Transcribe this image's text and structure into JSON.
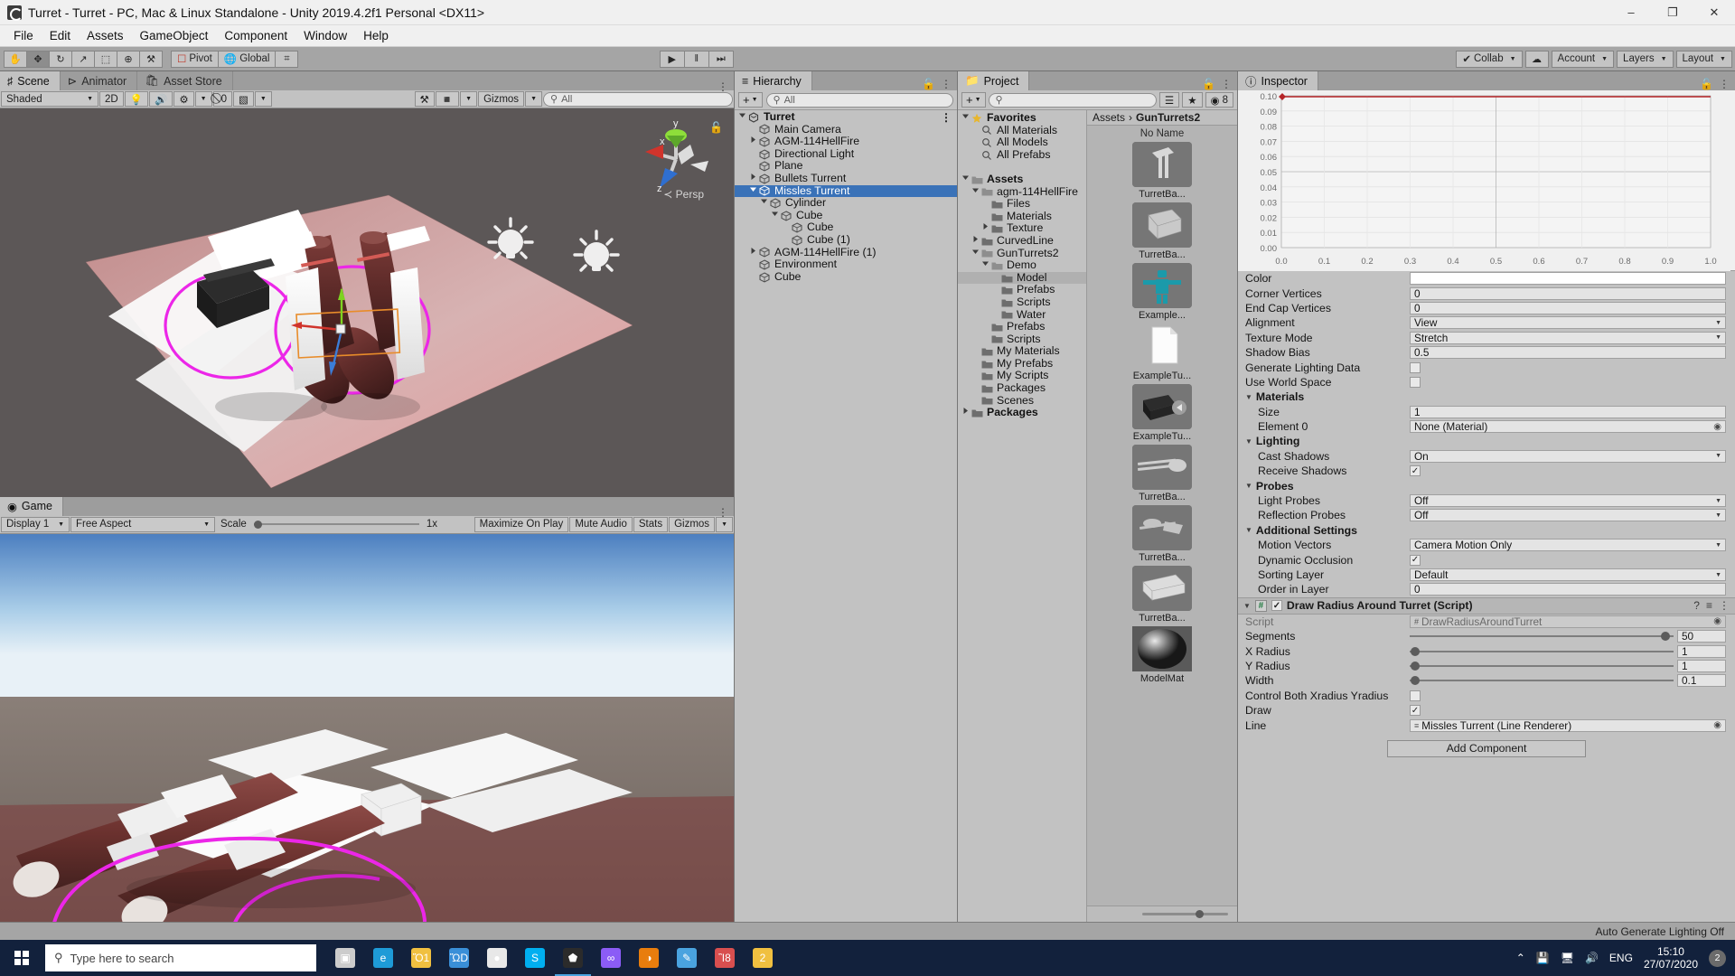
{
  "window": {
    "title": "Turret - Turret - PC, Mac & Linux Standalone - Unity 2019.4.2f1 Personal <DX11>",
    "minimize": "–",
    "maximize": "❐",
    "close": "✕"
  },
  "menubar": {
    "items": [
      "File",
      "Edit",
      "Assets",
      "GameObject",
      "Component",
      "Window",
      "Help"
    ]
  },
  "toolbar": {
    "tools": [
      {
        "name": "hand-tool",
        "glyph": "✋",
        "active": false
      },
      {
        "name": "move-tool",
        "glyph": "✥",
        "active": true
      },
      {
        "name": "rotate-tool",
        "glyph": "↻",
        "active": false
      },
      {
        "name": "scale-tool",
        "glyph": "↗",
        "active": false
      },
      {
        "name": "rect-tool",
        "glyph": "⬚",
        "active": false
      },
      {
        "name": "transform-tool",
        "glyph": "⊕",
        "active": false
      },
      {
        "name": "custom-tool",
        "glyph": "⚒",
        "active": false
      }
    ],
    "pivot_label": "Pivot",
    "global_label": "Global",
    "grid_label": "⌗",
    "play": "▶",
    "pause": "‖",
    "step": "⏭",
    "collab_label": "Collab",
    "cloud_label": "☁",
    "account_label": "Account",
    "layers_label": "Layers",
    "layout_label": "Layout"
  },
  "scene_panel": {
    "tabs": [
      {
        "label": "Scene",
        "icon": "grid-icon",
        "active": true
      },
      {
        "label": "Animator",
        "icon": "animator-icon",
        "active": false
      },
      {
        "label": "Asset Store",
        "icon": "store-icon",
        "active": false
      }
    ],
    "shading_mode": "Shaded",
    "two_d": "2D",
    "light_toggle": "Ὂ1",
    "audio_toggle": "ὐA",
    "fx_toggle": "fx",
    "hidden_count": "0",
    "gizmos_label": "Gizmos",
    "search_placeholder": "All",
    "persp_label": "Persp",
    "axis_x": "x",
    "axis_y": "y",
    "axis_z": "z"
  },
  "game_panel": {
    "tab_label": "Game",
    "display": "Display 1",
    "aspect": "Free Aspect",
    "scale_label": "Scale",
    "scale_value": "1x",
    "maximize_on_play": "Maximize On Play",
    "mute_audio": "Mute Audio",
    "stats": "Stats",
    "gizmos": "Gizmos"
  },
  "hierarchy": {
    "tab_label": "Hierarchy",
    "add_label": "+",
    "search_placeholder": "All",
    "items": [
      {
        "label": "Turret",
        "depth": 0,
        "arrow": "down",
        "bold": true,
        "selected": false,
        "icon": "unity-scene-icon"
      },
      {
        "label": "Main Camera",
        "depth": 1,
        "arrow": "none",
        "bold": false,
        "selected": false,
        "icon": "gameobject-icon"
      },
      {
        "label": "AGM-114HellFire",
        "depth": 1,
        "arrow": "right",
        "bold": false,
        "selected": false,
        "icon": "gameobject-icon"
      },
      {
        "label": "Directional Light",
        "depth": 1,
        "arrow": "none",
        "bold": false,
        "selected": false,
        "icon": "gameobject-icon"
      },
      {
        "label": "Plane",
        "depth": 1,
        "arrow": "none",
        "bold": false,
        "selected": false,
        "icon": "gameobject-icon"
      },
      {
        "label": "Bullets Turrent",
        "depth": 1,
        "arrow": "right",
        "bold": false,
        "selected": false,
        "icon": "gameobject-icon"
      },
      {
        "label": "Missles Turrent",
        "depth": 1,
        "arrow": "down",
        "bold": false,
        "selected": true,
        "icon": "gameobject-icon"
      },
      {
        "label": "Cylinder",
        "depth": 2,
        "arrow": "down",
        "bold": false,
        "selected": false,
        "icon": "gameobject-icon"
      },
      {
        "label": "Cube",
        "depth": 3,
        "arrow": "down",
        "bold": false,
        "selected": false,
        "icon": "gameobject-icon"
      },
      {
        "label": "Cube",
        "depth": 4,
        "arrow": "none",
        "bold": false,
        "selected": false,
        "icon": "gameobject-icon"
      },
      {
        "label": "Cube (1)",
        "depth": 4,
        "arrow": "none",
        "bold": false,
        "selected": false,
        "icon": "gameobject-icon"
      },
      {
        "label": "AGM-114HellFire (1)",
        "depth": 1,
        "arrow": "right",
        "bold": false,
        "selected": false,
        "icon": "gameobject-icon"
      },
      {
        "label": "Environment",
        "depth": 1,
        "arrow": "none",
        "bold": false,
        "selected": false,
        "icon": "gameobject-icon"
      },
      {
        "label": "Cube",
        "depth": 1,
        "arrow": "none",
        "bold": false,
        "selected": false,
        "icon": "gameobject-icon"
      }
    ]
  },
  "project": {
    "tab_label": "Project",
    "add_label": "+",
    "search_placeholder": "",
    "count_badge": "8",
    "breadcrumb": [
      "Assets",
      "GunTurrets2"
    ],
    "breadcrumb_sep": "›",
    "no_name_label": "No Name",
    "tree": [
      {
        "label": "Favorites",
        "depth": 0,
        "arrow": "down",
        "bold": true,
        "icon": "star-icon",
        "selected": false
      },
      {
        "label": "All Materials",
        "depth": 1,
        "arrow": "none",
        "bold": false,
        "icon": "search-icon",
        "selected": false
      },
      {
        "label": "All Models",
        "depth": 1,
        "arrow": "none",
        "bold": false,
        "icon": "search-icon",
        "selected": false
      },
      {
        "label": "All Prefabs",
        "depth": 1,
        "arrow": "none",
        "bold": false,
        "icon": "search-icon",
        "selected": false
      },
      {
        "label": "",
        "depth": 0,
        "arrow": "none",
        "bold": false,
        "icon": "none",
        "selected": false
      },
      {
        "label": "Assets",
        "depth": 0,
        "arrow": "down",
        "bold": true,
        "icon": "folder-open-icon",
        "selected": false
      },
      {
        "label": "agm-114HellFire",
        "depth": 1,
        "arrow": "down",
        "bold": false,
        "icon": "folder-open-icon",
        "selected": false
      },
      {
        "label": "Files",
        "depth": 2,
        "arrow": "none",
        "bold": false,
        "icon": "folder-icon",
        "selected": false
      },
      {
        "label": "Materials",
        "depth": 2,
        "arrow": "none",
        "bold": false,
        "icon": "folder-icon",
        "selected": false
      },
      {
        "label": "Texture",
        "depth": 2,
        "arrow": "right",
        "bold": false,
        "icon": "folder-icon",
        "selected": false
      },
      {
        "label": "CurvedLine",
        "depth": 1,
        "arrow": "right",
        "bold": false,
        "icon": "folder-icon",
        "selected": false
      },
      {
        "label": "GunTurrets2",
        "depth": 1,
        "arrow": "down",
        "bold": false,
        "icon": "folder-open-icon",
        "selected": false
      },
      {
        "label": "Demo",
        "depth": 2,
        "arrow": "down",
        "bold": false,
        "icon": "folder-open-icon",
        "selected": false
      },
      {
        "label": "Model",
        "depth": 3,
        "arrow": "none",
        "bold": false,
        "icon": "folder-icon",
        "selected": true
      },
      {
        "label": "Prefabs",
        "depth": 3,
        "arrow": "none",
        "bold": false,
        "icon": "folder-icon",
        "selected": false
      },
      {
        "label": "Scripts",
        "depth": 3,
        "arrow": "none",
        "bold": false,
        "icon": "folder-icon",
        "selected": false
      },
      {
        "label": "Water",
        "depth": 3,
        "arrow": "none",
        "bold": false,
        "icon": "folder-icon",
        "selected": false
      },
      {
        "label": "Prefabs",
        "depth": 2,
        "arrow": "none",
        "bold": false,
        "icon": "folder-icon",
        "selected": false
      },
      {
        "label": "Scripts",
        "depth": 2,
        "arrow": "none",
        "bold": false,
        "icon": "folder-icon",
        "selected": false
      },
      {
        "label": "My Materials",
        "depth": 1,
        "arrow": "none",
        "bold": false,
        "icon": "folder-icon",
        "selected": false
      },
      {
        "label": "My Prefabs",
        "depth": 1,
        "arrow": "none",
        "bold": false,
        "icon": "folder-icon",
        "selected": false
      },
      {
        "label": "My Scripts",
        "depth": 1,
        "arrow": "none",
        "bold": false,
        "icon": "folder-icon",
        "selected": false
      },
      {
        "label": "Packages",
        "depth": 1,
        "arrow": "none",
        "bold": false,
        "icon": "folder-icon",
        "selected": false
      },
      {
        "label": "Scenes",
        "depth": 1,
        "arrow": "none",
        "bold": false,
        "icon": "folder-icon",
        "selected": false
      },
      {
        "label": "Packages",
        "depth": 0,
        "arrow": "right",
        "bold": true,
        "icon": "folder-icon",
        "selected": false
      }
    ],
    "assets": [
      {
        "label": "TurretBa...",
        "kind": "model-turret-base"
      },
      {
        "label": "TurretBa...",
        "kind": "model-box"
      },
      {
        "label": "Example...",
        "kind": "model-figure"
      },
      {
        "label": "ExampleTu...",
        "kind": "script-file"
      },
      {
        "label": "ExampleTu...",
        "kind": "prefab-cannon"
      },
      {
        "label": "TurretBa...",
        "kind": "model-barrel"
      },
      {
        "label": "TurretBa...",
        "kind": "model-gun"
      },
      {
        "label": "TurretBa...",
        "kind": "model-wedge"
      },
      {
        "label": "ModelMat",
        "kind": "material-sphere"
      }
    ]
  },
  "inspector": {
    "tab_label": "Inspector",
    "curve": {
      "y_ticks": [
        "0.10",
        "0.09",
        "0.08",
        "0.07",
        "0.06",
        "0.05",
        "0.04",
        "0.03",
        "0.02",
        "0.01",
        "0.00"
      ],
      "x_ticks": [
        "0.0",
        "0.1",
        "0.2",
        "0.3",
        "0.4",
        "0.5",
        "0.6",
        "0.7",
        "0.8",
        "0.9",
        "1.0"
      ],
      "line_color": "#b52528",
      "value": 0.1
    },
    "line_renderer": [
      {
        "label": "Color",
        "type": "color",
        "value": "#ffffff",
        "indent": 0
      },
      {
        "label": "Corner Vertices",
        "type": "text",
        "value": "0",
        "indent": 0
      },
      {
        "label": "End Cap Vertices",
        "type": "text",
        "value": "0",
        "indent": 0
      },
      {
        "label": "Alignment",
        "type": "dropdown",
        "value": "View",
        "indent": 0
      },
      {
        "label": "Texture Mode",
        "type": "dropdown",
        "value": "Stretch",
        "indent": 0
      },
      {
        "label": "Shadow Bias",
        "type": "text",
        "value": "0.5",
        "indent": 0
      },
      {
        "label": "Generate Lighting Data",
        "type": "checkbox",
        "value": false,
        "indent": 0
      },
      {
        "label": "Use World Space",
        "type": "checkbox",
        "value": false,
        "indent": 0
      },
      {
        "label": "Materials",
        "type": "foldout",
        "value": "",
        "indent": 0
      },
      {
        "label": "Size",
        "type": "text",
        "value": "1",
        "indent": 1
      },
      {
        "label": "Element 0",
        "type": "object",
        "value": "None (Material)",
        "indent": 1
      },
      {
        "label": "Lighting",
        "type": "foldout",
        "value": "",
        "indent": 0
      },
      {
        "label": "Cast Shadows",
        "type": "dropdown",
        "value": "On",
        "indent": 1
      },
      {
        "label": "Receive Shadows",
        "type": "checkbox",
        "value": true,
        "indent": 1
      },
      {
        "label": "Probes",
        "type": "foldout",
        "value": "",
        "indent": 0
      },
      {
        "label": "Light Probes",
        "type": "dropdown",
        "value": "Off",
        "indent": 1
      },
      {
        "label": "Reflection Probes",
        "type": "dropdown",
        "value": "Off",
        "indent": 1
      },
      {
        "label": "Additional Settings",
        "type": "foldout",
        "value": "",
        "indent": 0
      },
      {
        "label": "Motion Vectors",
        "type": "dropdown",
        "value": "Camera Motion Only",
        "indent": 1
      },
      {
        "label": "Dynamic Occlusion",
        "type": "checkbox",
        "value": true,
        "indent": 1
      },
      {
        "label": "Sorting Layer",
        "type": "dropdown",
        "value": "Default",
        "indent": 1
      },
      {
        "label": "Order in Layer",
        "type": "text",
        "value": "0",
        "indent": 1
      }
    ],
    "script_component": {
      "title": "Draw Radius Around Turret (Script)",
      "enabled": true,
      "hash_glyph": "#",
      "help_glyph": "?",
      "preset_glyph": "≡",
      "menu_glyph": "⋮",
      "rows": [
        {
          "label": "Script",
          "type": "object-dim",
          "value": "DrawRadiusAroundTurret"
        },
        {
          "label": "Segments",
          "type": "slider",
          "value": "50",
          "pct": 97
        },
        {
          "label": "X Radius",
          "type": "slider",
          "value": "1",
          "pct": 2
        },
        {
          "label": "Y Radius",
          "type": "slider",
          "value": "1",
          "pct": 2
        },
        {
          "label": "Width",
          "type": "slider",
          "value": "0.1",
          "pct": 2
        },
        {
          "label": "Control Both Xradius Yradius",
          "type": "checkbox",
          "value": false
        },
        {
          "label": "Draw",
          "type": "checkbox",
          "value": true
        },
        {
          "label": "Line",
          "type": "object",
          "value": "Missles Turrent (Line Renderer)"
        }
      ]
    },
    "add_component_label": "Add Component"
  },
  "statusbar": {
    "text": "Auto Generate Lighting Off"
  },
  "taskbar": {
    "search_placeholder": "Type here to search",
    "apps": [
      {
        "name": "task-view-icon",
        "glyph": "▣"
      },
      {
        "name": "edge-icon",
        "glyph": "e"
      },
      {
        "name": "file-explorer-icon",
        "glyph": "Ὄ1"
      },
      {
        "name": "store-icon",
        "glyph": "ὬD"
      },
      {
        "name": "chrome-icon",
        "glyph": "●"
      },
      {
        "name": "skype-icon",
        "glyph": "S"
      },
      {
        "name": "unity-icon",
        "glyph": "⬟"
      },
      {
        "name": "visual-studio-icon",
        "glyph": "∞"
      },
      {
        "name": "blender-icon",
        "glyph": "◑"
      },
      {
        "name": "notepad-icon",
        "glyph": "✎"
      },
      {
        "name": "paint-icon",
        "glyph": "Ἲ8"
      },
      {
        "name": "folder2-icon",
        "glyph": "὜2"
      }
    ],
    "tray": {
      "chevron": "⌃",
      "lang": "ENG",
      "time": "15:10",
      "date": "27/07/2020",
      "notif_count": "2"
    }
  }
}
